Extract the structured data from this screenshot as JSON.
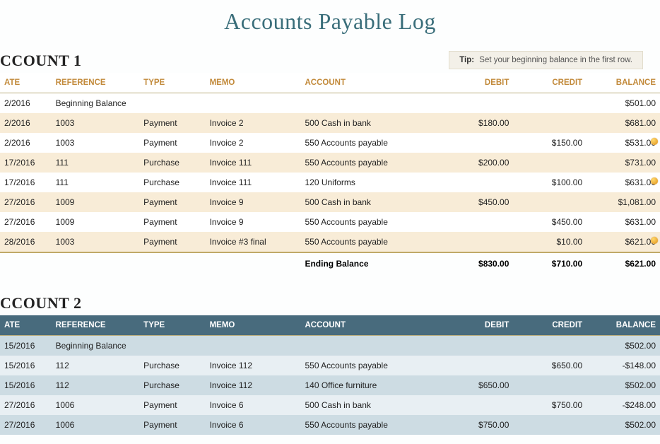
{
  "title": "Accounts Payable Log",
  "tip": {
    "label": "Tip:",
    "text": "Set your beginning balance in the first row."
  },
  "columns": [
    "ATE",
    "REFERENCE",
    "TYPE",
    "MEMO",
    "ACCOUNT",
    "DEBIT",
    "CREDIT",
    "BALANCE"
  ],
  "account1": {
    "header": "CCOUNT 1",
    "rows": [
      {
        "date": "2/2016",
        "reference": "Beginning Balance",
        "type": "",
        "memo": "",
        "account": "",
        "debit": "",
        "credit": "",
        "balance": "$501.00",
        "marker": false
      },
      {
        "date": "2/2016",
        "reference": "1003",
        "type": "Payment",
        "memo": "Invoice 2",
        "account": "500 Cash in bank",
        "debit": "$180.00",
        "credit": "",
        "balance": "$681.00",
        "marker": false
      },
      {
        "date": "2/2016",
        "reference": "1003",
        "type": "Payment",
        "memo": "Invoice 2",
        "account": "550 Accounts payable",
        "debit": "",
        "credit": "$150.00",
        "balance": "$531.00",
        "marker": true
      },
      {
        "date": "17/2016",
        "reference": "111",
        "type": "Purchase",
        "memo": "Invoice 111",
        "account": "550 Accounts payable",
        "debit": "$200.00",
        "credit": "",
        "balance": "$731.00",
        "marker": false
      },
      {
        "date": "17/2016",
        "reference": "111",
        "type": "Purchase",
        "memo": "Invoice 111",
        "account": "120 Uniforms",
        "debit": "",
        "credit": "$100.00",
        "balance": "$631.00",
        "marker": true
      },
      {
        "date": "27/2016",
        "reference": "1009",
        "type": "Payment",
        "memo": "Invoice 9",
        "account": "500 Cash in bank",
        "debit": "$450.00",
        "credit": "",
        "balance": "$1,081.00",
        "marker": false
      },
      {
        "date": "27/2016",
        "reference": "1009",
        "type": "Payment",
        "memo": "Invoice 9",
        "account": "550 Accounts payable",
        "debit": "",
        "credit": "$450.00",
        "balance": "$631.00",
        "marker": false
      },
      {
        "date": "28/2016",
        "reference": "1003",
        "type": "Payment",
        "memo": "Invoice #3 final",
        "account": "550 Accounts payable",
        "debit": "",
        "credit": "$10.00",
        "balance": "$621.00",
        "marker": true
      }
    ],
    "footer": {
      "label": "Ending Balance",
      "debit": "$830.00",
      "credit": "$710.00",
      "balance": "$621.00"
    }
  },
  "account2": {
    "header": "CCOUNT 2",
    "rows": [
      {
        "date": "15/2016",
        "reference": "Beginning Balance",
        "type": "",
        "memo": "",
        "account": "",
        "debit": "",
        "credit": "",
        "balance": "$502.00"
      },
      {
        "date": "15/2016",
        "reference": "112",
        "type": "Purchase",
        "memo": "Invoice 112",
        "account": "550 Accounts payable",
        "debit": "",
        "credit": "$650.00",
        "balance": "-$148.00"
      },
      {
        "date": "15/2016",
        "reference": "112",
        "type": "Purchase",
        "memo": "Invoice 112",
        "account": "140 Office furniture",
        "debit": "$650.00",
        "credit": "",
        "balance": "$502.00"
      },
      {
        "date": "27/2016",
        "reference": "1006",
        "type": "Payment",
        "memo": "Invoice 6",
        "account": "500 Cash in bank",
        "debit": "",
        "credit": "$750.00",
        "balance": "-$248.00"
      },
      {
        "date": "27/2016",
        "reference": "1006",
        "type": "Payment",
        "memo": "Invoice 6",
        "account": "550 Accounts payable",
        "debit": "$750.00",
        "credit": "",
        "balance": "$502.00"
      }
    ]
  }
}
